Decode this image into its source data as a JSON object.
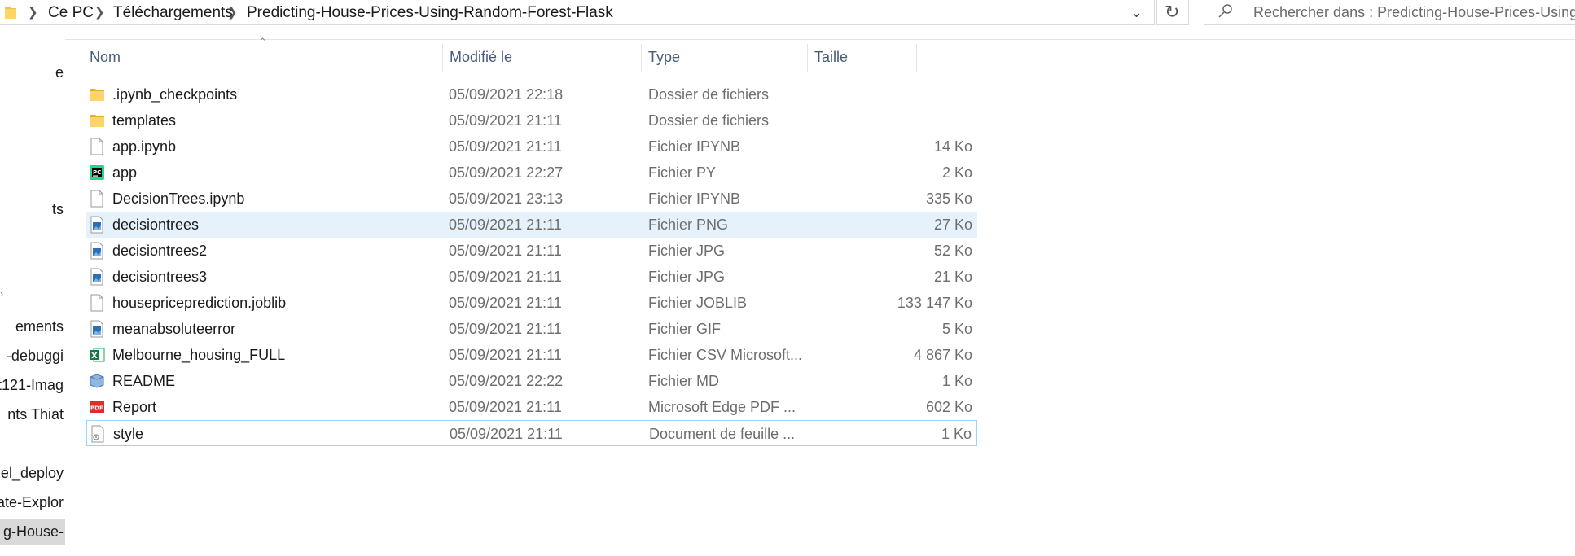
{
  "address_bar": {
    "breadcrumbs": [
      "Ce PC",
      "Téléchargements",
      "Predicting-House-Prices-Using-Random-Forest-Flask"
    ],
    "search_placeholder": "Rechercher dans : Predicting-House-Prices-Using-R"
  },
  "nav": {
    "items": [
      {
        "label": "e"
      },
      {
        "label": "ts"
      },
      {
        "label": "ements"
      },
      {
        "label": "-debuggi"
      },
      {
        "label": "t121-Imag"
      },
      {
        "label": "nts Thiat"
      },
      {
        "label": "del_deploy"
      },
      {
        "label": "ate-Explor"
      },
      {
        "label": "g-House-"
      }
    ]
  },
  "columns": {
    "name": "Nom",
    "modified": "Modifié le",
    "type": "Type",
    "size": "Taille"
  },
  "files": [
    {
      "name": ".ipynb_checkpoints",
      "modified": "05/09/2021 22:18",
      "type": "Dossier de fichiers",
      "size": "",
      "icon": "folder-icon"
    },
    {
      "name": "templates",
      "modified": "05/09/2021 21:11",
      "type": "Dossier de fichiers",
      "size": "",
      "icon": "folder-icon"
    },
    {
      "name": "app.ipynb",
      "modified": "05/09/2021 21:11",
      "type": "Fichier IPYNB",
      "size": "14 Ko",
      "icon": "file-icon"
    },
    {
      "name": "app",
      "modified": "05/09/2021 22:27",
      "type": "Fichier PY",
      "size": "2 Ko",
      "icon": "pycharm-icon"
    },
    {
      "name": "DecisionTrees.ipynb",
      "modified": "05/09/2021 23:13",
      "type": "Fichier IPYNB",
      "size": "335 Ko",
      "icon": "file-icon"
    },
    {
      "name": "decisiontrees",
      "modified": "05/09/2021 21:11",
      "type": "Fichier PNG",
      "size": "27 Ko",
      "icon": "image-icon"
    },
    {
      "name": "decisiontrees2",
      "modified": "05/09/2021 21:11",
      "type": "Fichier JPG",
      "size": "52 Ko",
      "icon": "image-icon"
    },
    {
      "name": "decisiontrees3",
      "modified": "05/09/2021 21:11",
      "type": "Fichier JPG",
      "size": "21 Ko",
      "icon": "image-icon"
    },
    {
      "name": "housepriceprediction.joblib",
      "modified": "05/09/2021 21:11",
      "type": "Fichier JOBLIB",
      "size": "133 147 Ko",
      "icon": "file-icon"
    },
    {
      "name": "meanabsoluteerror",
      "modified": "05/09/2021 21:11",
      "type": "Fichier GIF",
      "size": "5 Ko",
      "icon": "image-icon"
    },
    {
      "name": "Melbourne_housing_FULL",
      "modified": "05/09/2021 21:11",
      "type": "Fichier CSV Microsoft...",
      "size": "4 867 Ko",
      "icon": "excel-icon"
    },
    {
      "name": "README",
      "modified": "05/09/2021 22:22",
      "type": "Fichier MD",
      "size": "1 Ko",
      "icon": "markdown-icon"
    },
    {
      "name": "Report",
      "modified": "05/09/2021 21:11",
      "type": "Microsoft Edge PDF ...",
      "size": "602 Ko",
      "icon": "pdf-icon"
    },
    {
      "name": "style",
      "modified": "05/09/2021 21:11",
      "type": "Document de feuille ...",
      "size": "1 Ko",
      "icon": "css-icon"
    }
  ]
}
